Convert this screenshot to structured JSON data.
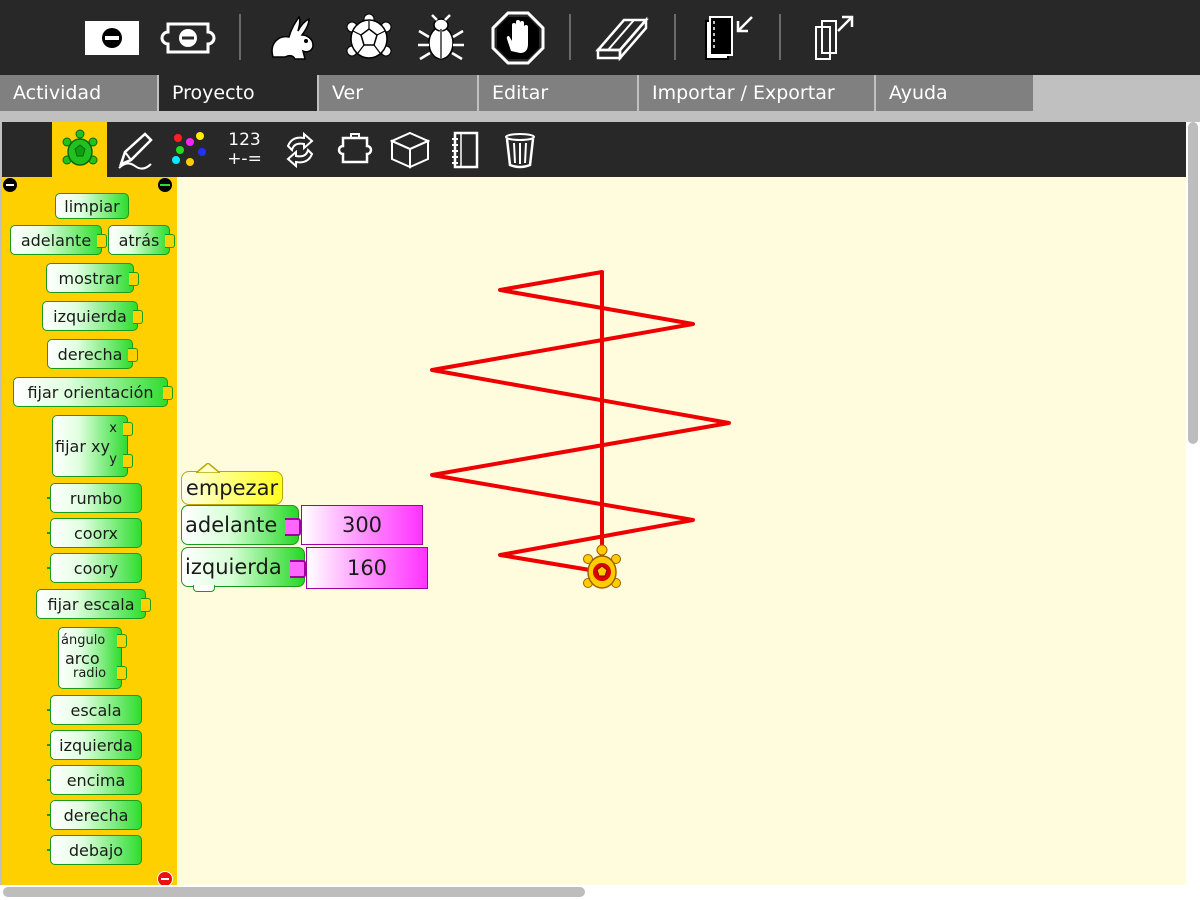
{
  "toolbar": {
    "buttons": [
      {
        "id": "stop-palette",
        "icon": "minus-box-icon"
      },
      {
        "id": "hide-blocks",
        "icon": "hide-blocks-icon"
      },
      {
        "id": "run-fast",
        "icon": "rabbit-icon"
      },
      {
        "id": "run-slow",
        "icon": "turtle-icon"
      },
      {
        "id": "debug",
        "icon": "bug-icon"
      },
      {
        "id": "stop",
        "icon": "hand-stop-icon"
      },
      {
        "id": "clear",
        "icon": "eraser-icon"
      },
      {
        "id": "load",
        "icon": "import-journal-icon"
      },
      {
        "id": "share",
        "icon": "export-icon"
      }
    ]
  },
  "tabs": [
    "Actividad",
    "Proyecto",
    "Ver",
    "Editar",
    "Importar / Exportar",
    "Ayuda"
  ],
  "palette_tabs": {
    "numbers_label_top": "123",
    "numbers_label_bottom": "+-="
  },
  "palette": {
    "blocks": {
      "clean": "limpiar",
      "forward": "adelante",
      "back": "atrás",
      "show": "mostrar",
      "left": "izquierda",
      "right": "derecha",
      "seth": "fijar orientación",
      "setxy": "fijar xy",
      "setxy_x": "x",
      "setxy_y": "y",
      "heading": "rumbo",
      "xcor": "coorx",
      "ycor": "coory",
      "setscale": "fijar escala",
      "arc": "arco",
      "arc_angle": "ángulo",
      "arc_radius": "radio",
      "scale": "escala",
      "leftpos": "izquierda",
      "toppos": "encima",
      "rightpos": "derecha",
      "bottompos": "debajo"
    }
  },
  "canvas": {
    "program": {
      "start": "empezar",
      "forward": "adelante",
      "forward_value": "300",
      "left": "izquierda",
      "left_value": "160"
    }
  },
  "colors": {
    "toolbar_bg": "#282828",
    "palette_bg": "#ffd000",
    "canvas_bg": "#fefcdd",
    "turtle_line": "#ee0000",
    "number_block": "#ff44ff",
    "start_block": "#ffff33"
  }
}
